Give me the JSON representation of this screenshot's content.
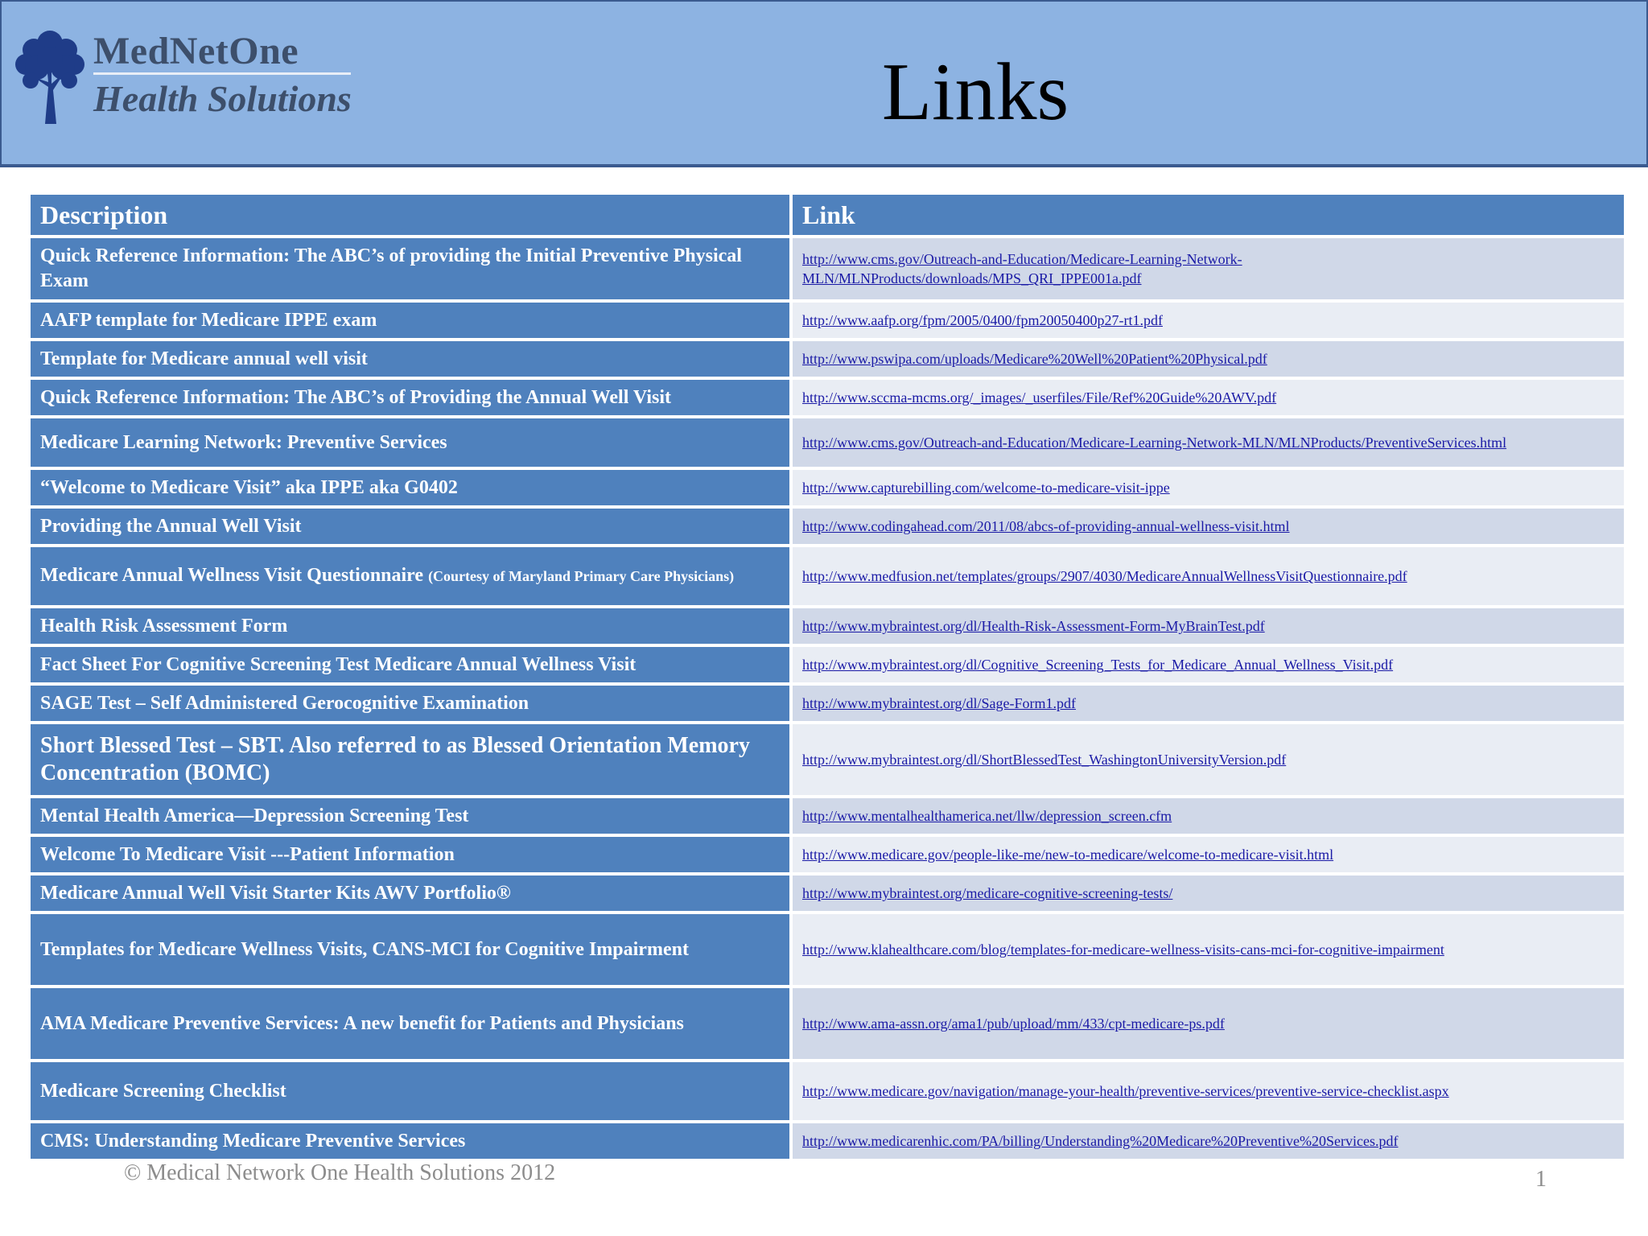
{
  "header": {
    "logo_name": "MedNetOne",
    "logo_sub": "Health Solutions",
    "title": "Links"
  },
  "table": {
    "columns": [
      "Description",
      "Link"
    ],
    "rows": [
      {
        "description": "Quick Reference Information: The ABC’s of providing the Initial Preventive Physical Exam",
        "link": "http://www.cms.gov/Outreach-and-Education/Medicare-Learning-Network-MLN/MLNProducts/downloads/MPS_QRI_IPPE001a.pdf"
      },
      {
        "description": "AAFP template for Medicare IPPE exam",
        "link": "http://www.aafp.org/fpm/2005/0400/fpm20050400p27-rt1.pdf"
      },
      {
        "description": "Template for Medicare annual well visit",
        "link": "http://www.pswipa.com/uploads/Medicare%20Well%20Patient%20Physical.pdf"
      },
      {
        "description": "Quick Reference Information: The ABC’s of Providing the Annual Well Visit",
        "link": "http://www.sccma-mcms.org/_images/_userfiles/File/Ref%20Guide%20AWV.pdf"
      },
      {
        "description": "Medicare Learning Network: Preventive Services",
        "link": "http://www.cms.gov/Outreach-and-Education/Medicare-Learning-Network-MLN/MLNProducts/PreventiveServices.html"
      },
      {
        "description": "“Welcome to Medicare Visit” aka IPPE aka G0402",
        "link": "http://www.capturebilling.com/welcome-to-medicare-visit-ippe"
      },
      {
        "description": "Providing the Annual Well Visit",
        "link": "http://www.codingahead.com/2011/08/abcs-of-providing-annual-wellness-visit.html"
      },
      {
        "description": "Medicare Annual Wellness Visit Questionnaire",
        "description_note": "(Courtesy of Maryland Primary Care Physicians)",
        "link": "http://www.medfusion.net/templates/groups/2907/4030/MedicareAnnualWellnessVisitQuestionnaire.pdf"
      },
      {
        "description": "Health Risk Assessment Form",
        "link": "http://www.mybraintest.org/dl/Health-Risk-Assessment-Form-MyBrainTest.pdf"
      },
      {
        "description": "Fact Sheet For Cognitive Screening Test Medicare Annual Wellness Visit",
        "link": "http://www.mybraintest.org/dl/Cognitive_Screening_Tests_for_Medicare_Annual_Wellness_Visit.pdf"
      },
      {
        "description": "SAGE Test – Self Administered Gerocognitive Examination",
        "link": "http://www.mybraintest.org/dl/Sage-Form1.pdf"
      },
      {
        "description": "Short Blessed Test – SBT. Also referred to as Blessed Orientation Memory Concentration (BOMC)",
        "link": "http://www.mybraintest.org/dl/ShortBlessedTest_WashingtonUniversityVersion.pdf"
      },
      {
        "description": "Mental Health America—Depression Screening Test",
        "link": "http://www.mentalhealthamerica.net/llw/depression_screen.cfm"
      },
      {
        "description": "Welcome To Medicare Visit ---Patient Information",
        "link": "http://www.medicare.gov/people-like-me/new-to-medicare/welcome-to-medicare-visit.html"
      },
      {
        "description": "Medicare Annual Well Visit Starter Kits AWV Portfolio®",
        "link": "http://www.mybraintest.org/medicare-cognitive-screening-tests/"
      },
      {
        "description": "Templates for Medicare Wellness Visits, CANS-MCI for Cognitive Impairment",
        "link": "http://www.klahealthcare.com/blog/templates-for-medicare-wellness-visits-cans-mci-for-cognitive-impairment"
      },
      {
        "description": "AMA Medicare Preventive Services: A new benefit for Patients and Physicians",
        "link": "http://www.ama-assn.org/ama1/pub/upload/mm/433/cpt-medicare-ps.pdf"
      },
      {
        "description": "Medicare Screening Checklist",
        "link": "http://www.medicare.gov/navigation/manage-your-health/preventive-services/preventive-service-checklist.aspx"
      },
      {
        "description": "CMS: Understanding Medicare Preventive Services",
        "link": "http://www.medicarenhic.com/PA/billing/Understanding%20Medicare%20Preventive%20Services.pdf"
      }
    ]
  },
  "footer": {
    "copyright": "© Medical Network One Health Solutions 2012",
    "page_number": "1"
  },
  "colors": {
    "header_bg": "#8db3e2",
    "cell_blue": "#4f81bd",
    "link_row_dark": "#d0d8e8",
    "link_row_light": "#e9edf4",
    "link_text": "#1a1aa6"
  }
}
